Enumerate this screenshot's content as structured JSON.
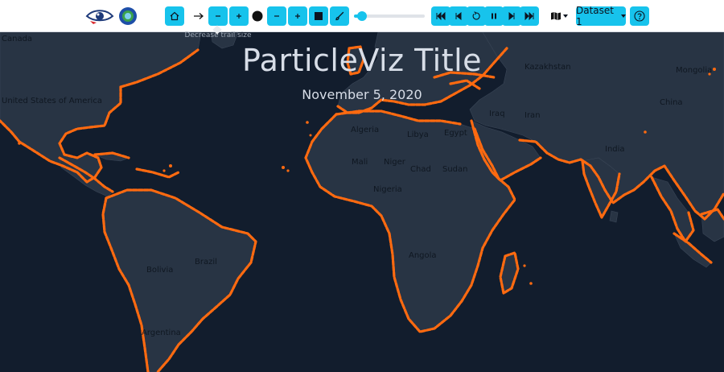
{
  "toolbar": {
    "tooltip": "Decrease trail size",
    "speed_fraction": 0.05,
    "dataset_label": "Dataset 1",
    "accent_color": "#17c3ec",
    "icons": [
      "eye-logo",
      "coaps-logo",
      "home-icon",
      "arrow-right-icon",
      "minus-icon",
      "plus-icon",
      "circle-icon",
      "square-icon",
      "brush-icon",
      "skip-back-icon",
      "step-back-icon",
      "reset-icon",
      "pause-icon",
      "step-forward-icon",
      "skip-forward-icon",
      "map-icon",
      "help-icon"
    ]
  },
  "map": {
    "title": "ParticleViz Title",
    "date": "November 5, 2020",
    "labels": {
      "canada": "Canada",
      "usa": "United States of America",
      "kazakhstan": "Kazakhstan",
      "mongolia": "Mongolia",
      "china": "China",
      "iraq": "Iraq",
      "iran": "Iran",
      "india": "India",
      "algeria": "Algeria",
      "libya": "Libya",
      "egypt": "Egypt",
      "mali": "Mali",
      "niger": "Niger",
      "chad": "Chad",
      "sudan": "Sudan",
      "nigeria": "Nigeria",
      "angola": "Angola",
      "bolivia": "Bolivia",
      "brazil": "Brazil",
      "argentina": "Argentina"
    },
    "colors": {
      "ocean": "#121d2d",
      "land": "#2a3645",
      "particles": "#ff6a10"
    }
  }
}
